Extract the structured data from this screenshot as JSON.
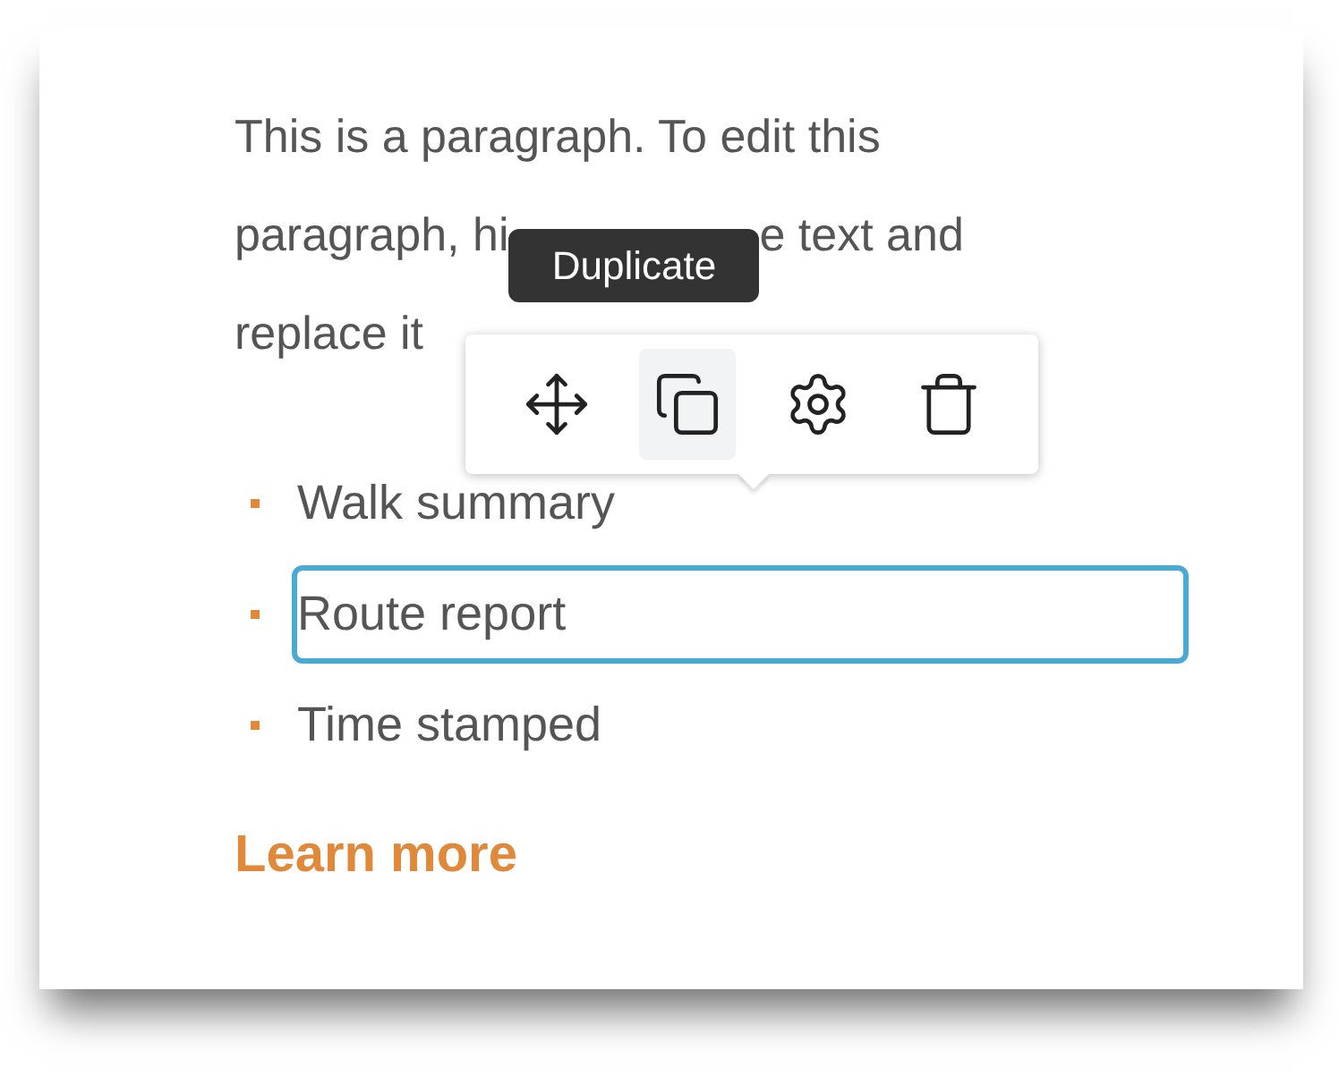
{
  "paragraph_lines": [
    {
      "segments": [
        "This is a paragraph. To edit this"
      ]
    },
    {
      "segments": [
        "paragraph, hi",
        "e text and"
      ]
    },
    {
      "segments": [
        "replace it"
      ]
    }
  ],
  "tooltip": {
    "text": "Duplicate"
  },
  "toolbar": {
    "buttons": [
      {
        "kind": "move",
        "selected": false
      },
      {
        "kind": "copy",
        "selected": true
      },
      {
        "kind": "settings",
        "selected": false
      },
      {
        "kind": "delete",
        "selected": false
      }
    ]
  },
  "list_items": [
    {
      "text": "Walk summary",
      "selected": false
    },
    {
      "text": "Route report",
      "selected": true
    },
    {
      "text": "Time stamped",
      "selected": false
    }
  ],
  "link": "Learn more"
}
